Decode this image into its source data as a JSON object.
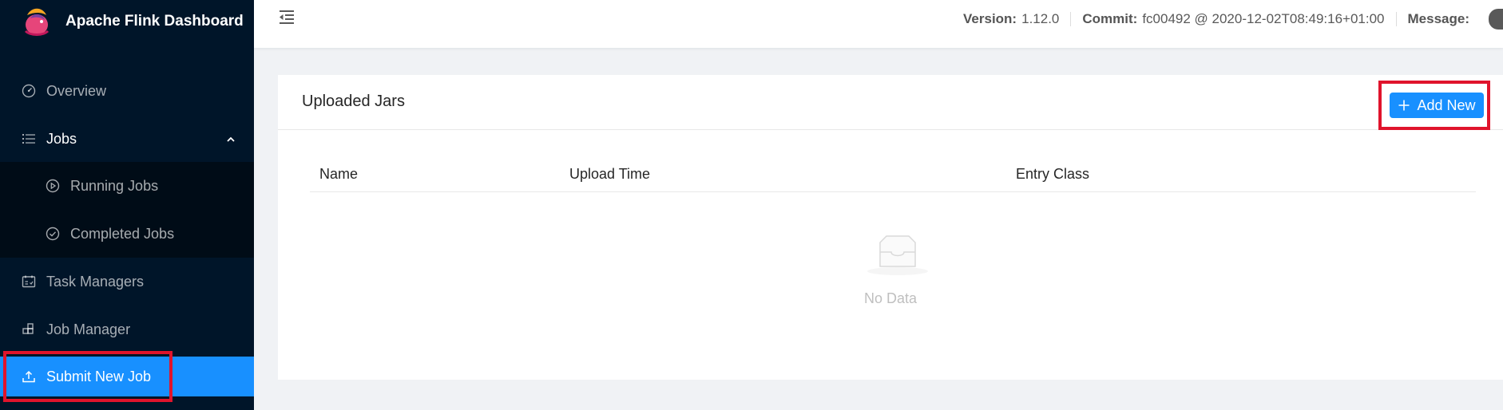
{
  "app": {
    "title": "Apache Flink Dashboard"
  },
  "sidebar": {
    "items": [
      {
        "label": "Overview",
        "icon": "dashboard-icon"
      },
      {
        "label": "Jobs",
        "icon": "list-icon"
      },
      {
        "label": "Running Jobs",
        "icon": "play-circle-icon"
      },
      {
        "label": "Completed Jobs",
        "icon": "check-circle-icon"
      },
      {
        "label": "Task Managers",
        "icon": "schedule-icon"
      },
      {
        "label": "Job Manager",
        "icon": "build-icon"
      },
      {
        "label": "Submit New Job",
        "icon": "upload-icon"
      }
    ],
    "active_item": "Submit New Job"
  },
  "header": {
    "version_label": "Version:",
    "version_value": "1.12.0",
    "commit_label": "Commit:",
    "commit_value": "fc00492 @ 2020-12-02T08:49:16+01:00",
    "message_label": "Message:"
  },
  "main": {
    "card_title": "Uploaded Jars",
    "add_button_label": "Add New",
    "table": {
      "columns": [
        "Name",
        "Upload Time",
        "Entry Class"
      ],
      "rows": []
    },
    "empty_text": "No Data"
  },
  "colors": {
    "sidebar_bg": "#001529",
    "submenu_bg": "#000c17",
    "accent": "#1890ff",
    "highlight_border": "#e0142c"
  }
}
